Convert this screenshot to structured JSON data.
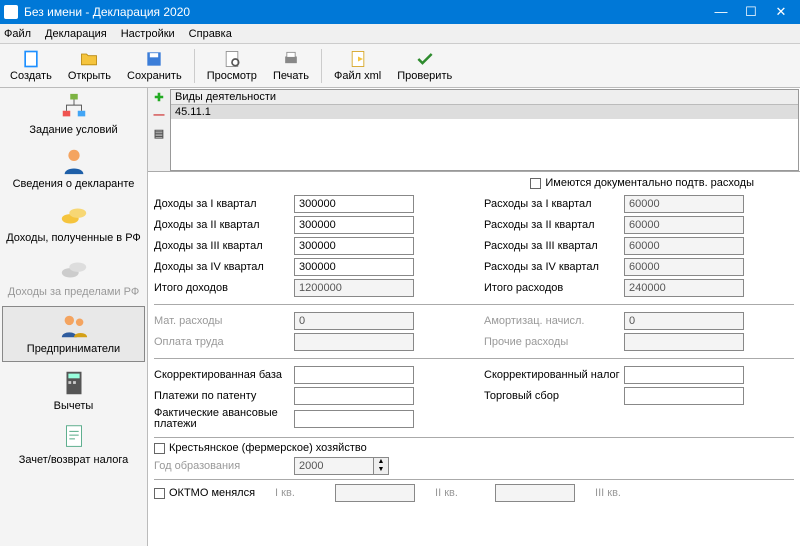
{
  "window": {
    "title": "Без имени - Декларация 2020"
  },
  "menu": {
    "file": "Файл",
    "decl": "Декларация",
    "settings": "Настройки",
    "help": "Справка"
  },
  "toolbar": {
    "create": "Создать",
    "open": "Открыть",
    "save": "Сохранить",
    "view": "Просмотр",
    "print": "Печать",
    "xml": "Файл xml",
    "check": "Проверить"
  },
  "sidebar": {
    "cond": "Задание условий",
    "decl": "Сведения о декларанте",
    "inc_rf": "Доходы, полученные в РФ",
    "inc_out": "Доходы за пределами РФ",
    "entr": "Предприниматели",
    "deduct": "Вычеты",
    "refund": "Зачет/возврат налога"
  },
  "list": {
    "header": "Виды деятельности",
    "row1": "45.11.1"
  },
  "form": {
    "hasdoc": "Имеются документально подтв. расходы",
    "inc_q1_l": "Доходы за I квартал",
    "inc_q1_v": "300000",
    "inc_q2_l": "Доходы за II квартал",
    "inc_q2_v": "300000",
    "inc_q3_l": "Доходы за III квартал",
    "inc_q3_v": "300000",
    "inc_q4_l": "Доходы за IV квартал",
    "inc_q4_v": "300000",
    "inc_tot_l": "Итого доходов",
    "inc_tot_v": "1200000",
    "exp_q1_l": "Расходы за I квартал",
    "exp_q1_v": "60000",
    "exp_q2_l": "Расходы за II квартал",
    "exp_q2_v": "60000",
    "exp_q3_l": "Расходы за III квартал",
    "exp_q3_v": "60000",
    "exp_q4_l": "Расходы за IV квартал",
    "exp_q4_v": "60000",
    "exp_tot_l": "Итого расходов",
    "exp_tot_v": "240000",
    "mat_l": "Мат. расходы",
    "mat_v": "0",
    "amort_l": "Амортизац. начисл.",
    "amort_v": "0",
    "pay_l": "Оплата труда",
    "other_l": "Прочие расходы",
    "corrbase_l": "Скорректированная база",
    "corrtax_l": "Скорректированный налог",
    "patent_l": "Платежи по патенту",
    "trade_l": "Торговый сбор",
    "advance_l": "Фактические авансовые платежи",
    "farm_l": "Крестьянское (фермерское) хозяйство",
    "year_l": "Год образования",
    "year_v": "2000",
    "oktmo_l": "ОКТМО менялся",
    "q1": "I кв.",
    "q2": "II кв.",
    "q3": "III кв."
  }
}
